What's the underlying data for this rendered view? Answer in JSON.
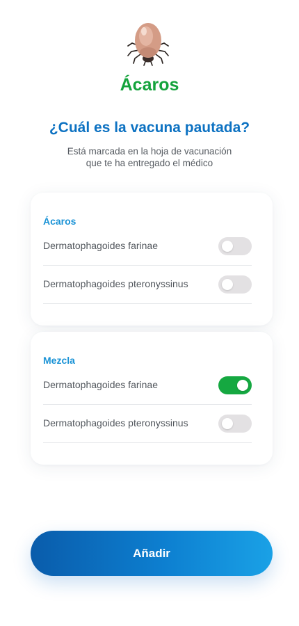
{
  "header": {
    "icon": "tick-mite-icon",
    "category_title": "Ácaros",
    "question": "¿Cuál es la vacuna pautada?",
    "hint_line1": "Está marcada en la hoja de vacunación",
    "hint_line2": "que te ha entregado el médico"
  },
  "groups": [
    {
      "title": "Ácaros",
      "items": [
        {
          "label": "Dermatophagoides farinae",
          "checked": false
        },
        {
          "label": "Dermatophagoides pteronyssinus",
          "checked": false
        }
      ]
    },
    {
      "title": "Mezcla",
      "items": [
        {
          "label": "Dermatophagoides farinae",
          "checked": true
        },
        {
          "label": "Dermatophagoides pteronyssinus",
          "checked": false
        }
      ]
    }
  ],
  "add_button": {
    "label": "Añadir"
  },
  "colors": {
    "category_green": "#14a33c",
    "question_blue": "#0d72c2",
    "toggle_on": "#15a841",
    "toggle_off": "#e3e1e3",
    "button_gradient_start": "#0a5cab",
    "button_gradient_end": "#1aa1e6"
  }
}
